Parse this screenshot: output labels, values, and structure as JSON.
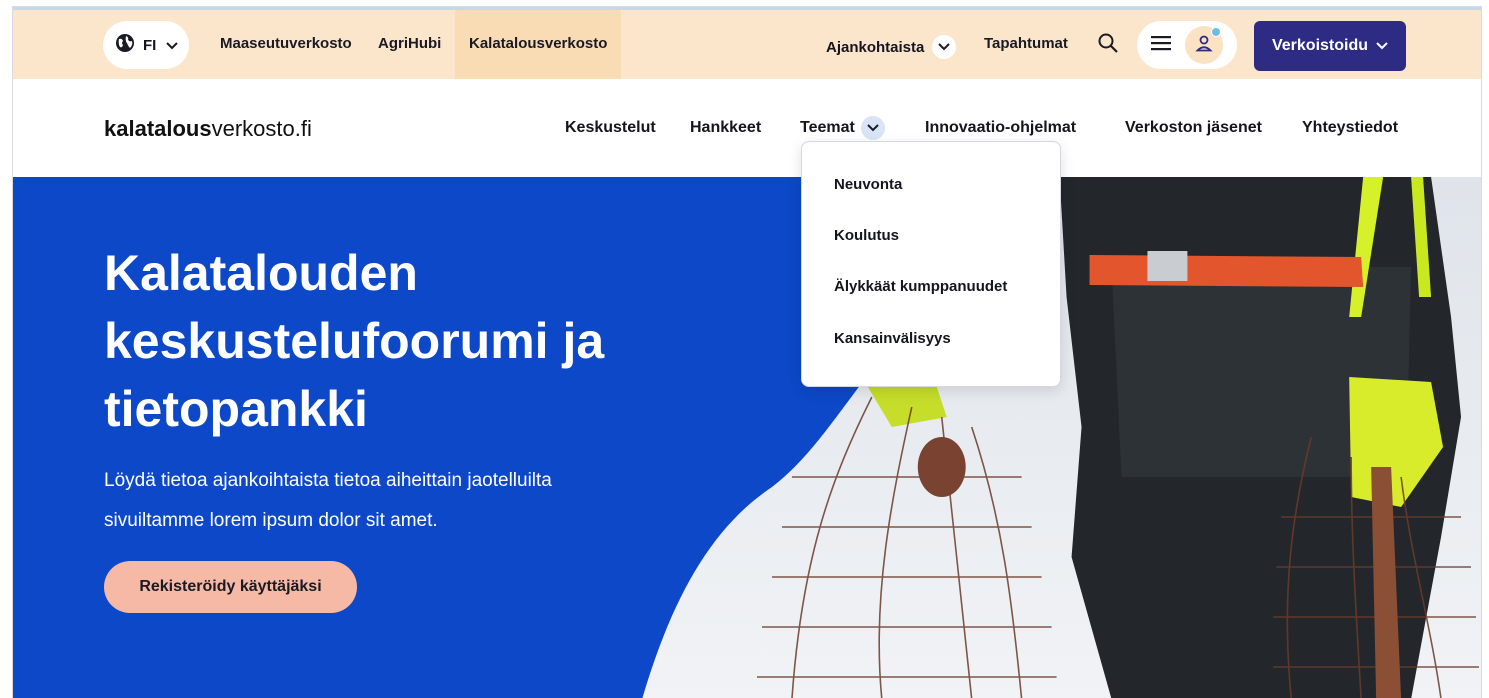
{
  "topbar": {
    "language": "FI",
    "links": [
      "Maaseutuverkosto",
      "AgriHubi",
      "Kalatalousverkosto"
    ],
    "active_link": "Kalatalousverkosto",
    "ajankohtaista": "Ajankohtaista",
    "tapahtumat": "Tapahtumat",
    "cta": "Verkoistoidu"
  },
  "header": {
    "logo_bold": "kalatalous",
    "logo_rest": "verkosto.fi",
    "nav": [
      "Keskustelut",
      "Hankkeet",
      "Teemat",
      "Innovaatio-ohjelmat",
      "Verkoston jäsenet",
      "Yhteystiedot"
    ]
  },
  "dropdown": {
    "items": [
      "Neuvonta",
      "Koulutus",
      "Älykkäät kumppanuudet",
      "Kansainvälisyys"
    ]
  },
  "hero": {
    "title": "Kalatalouden keskustelufoorumi ja tietopankki",
    "text": "Löydä tietoa ajankoihtaista tietoa aiheittain jaotelluilta sivuiltamme lorem ipsum dolor sit amet.",
    "button": "Rekisteröidy käyttäjäksi"
  },
  "colors": {
    "topbar_bg": "#fbe6cb",
    "hero_blue": "#0c48c7",
    "cta_purple": "#2e2b85",
    "hero_button": "#f5b9a6"
  },
  "icons": [
    "globe-icon",
    "chevron-down-icon",
    "search-icon",
    "hamburger-icon",
    "user-icon"
  ]
}
